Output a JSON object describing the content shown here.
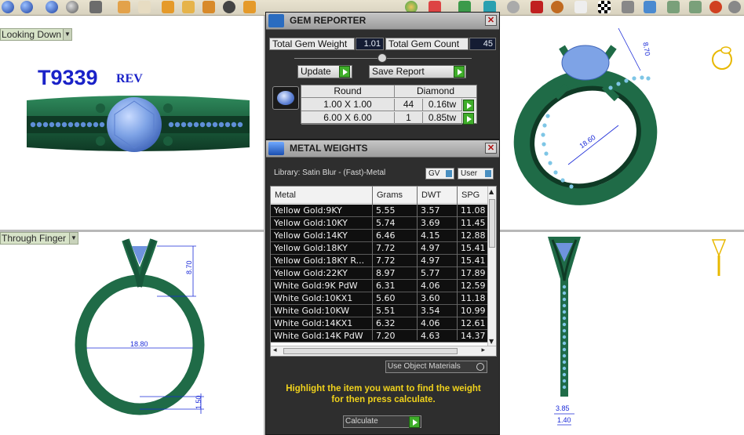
{
  "viewports": {
    "top_left": {
      "tab_label": "Looking Down",
      "sku": "T9339",
      "rev": "REV"
    },
    "bottom_left": {
      "tab_label": "Through Finger",
      "dims": [
        "8.70",
        "18.80",
        "1.50"
      ]
    },
    "top_right": {
      "dims": [
        "8.70",
        "18.60"
      ]
    },
    "bottom_right": {
      "dims": [
        "3.85",
        "1.40"
      ]
    }
  },
  "gem_reporter": {
    "title": "GEM REPORTER",
    "total_weight_label": "Total Gem Weight",
    "total_weight_value": "1.01",
    "total_count_label": "Total Gem Count",
    "total_count_value": "45",
    "update_label": "Update",
    "save_label": "Save Report",
    "table": {
      "headers": [
        "Round",
        "Diamond"
      ],
      "rows": [
        {
          "size": "1.00 X 1.00",
          "count": "44",
          "weight": "0.16tw"
        },
        {
          "size": "6.00 X 6.00",
          "count": "1",
          "weight": "0.85tw"
        }
      ]
    }
  },
  "metal_weights": {
    "title": "METAL WEIGHTS",
    "library": "Library: Satin Blur - (Fast)-Metal",
    "toggle_gv": "GV",
    "toggle_user": "User",
    "columns": [
      "Metal",
      "Grams",
      "DWT",
      "SPG"
    ],
    "rows": [
      {
        "metal": "Yellow Gold:9KY",
        "grams": "5.55",
        "dwt": "3.57",
        "spg": "11.08"
      },
      {
        "metal": "Yellow Gold:10KY",
        "grams": "5.74",
        "dwt": "3.69",
        "spg": "11.45"
      },
      {
        "metal": "Yellow Gold:14KY",
        "grams": "6.46",
        "dwt": "4.15",
        "spg": "12.88"
      },
      {
        "metal": "Yellow Gold:18KY",
        "grams": "7.72",
        "dwt": "4.97",
        "spg": "15.41"
      },
      {
        "metal": "Yellow Gold:18KY R...",
        "grams": "7.72",
        "dwt": "4.97",
        "spg": "15.41"
      },
      {
        "metal": "Yellow Gold:22KY",
        "grams": "8.97",
        "dwt": "5.77",
        "spg": "17.89"
      },
      {
        "metal": "White Gold:9K PdW",
        "grams": "6.31",
        "dwt": "4.06",
        "spg": "12.59"
      },
      {
        "metal": "White Gold:10KX1",
        "grams": "5.60",
        "dwt": "3.60",
        "spg": "11.18"
      },
      {
        "metal": "White Gold:10KW",
        "grams": "5.51",
        "dwt": "3.54",
        "spg": "10.99"
      },
      {
        "metal": "White Gold:14KX1",
        "grams": "6.32",
        "dwt": "4.06",
        "spg": "12.61"
      },
      {
        "metal": "White Gold:14K PdW",
        "grams": "7.20",
        "dwt": "4.63",
        "spg": "14.37"
      }
    ],
    "use_object_materials": "Use Object Materials",
    "hint_line1": "Highlight the item you want to find the weight",
    "hint_line2": "for then press calculate.",
    "calculate_label": "Calculate"
  },
  "colors": {
    "metal_green": "#1f6b47",
    "gem_blue": "#7ea3e6",
    "dim_blue": "#1a2ad8",
    "hint_yellow": "#f0d21c"
  }
}
